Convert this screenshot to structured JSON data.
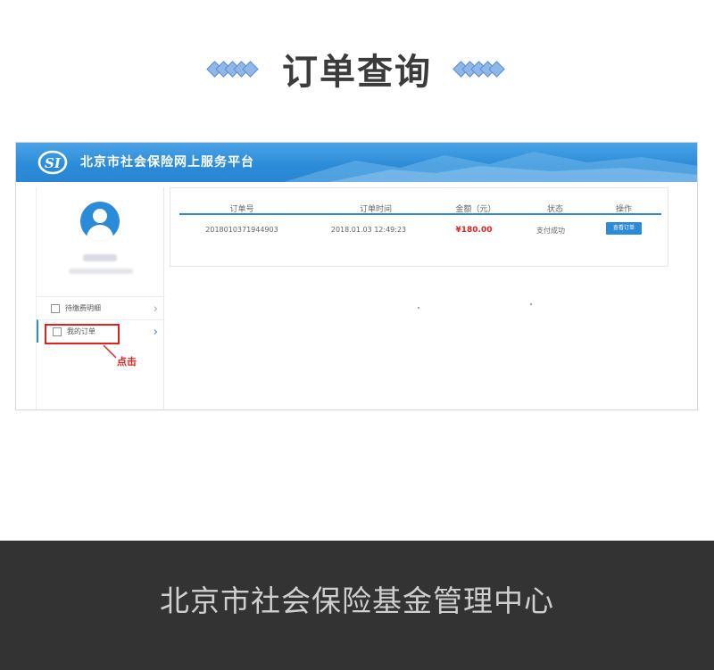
{
  "heading": {
    "title": "订单查询"
  },
  "portal": {
    "title": "北京市社会保险网上服务平台",
    "logo_text": "SI"
  },
  "sidebar": {
    "items": [
      {
        "label": "待缴费明细"
      },
      {
        "label": "我的订单"
      }
    ]
  },
  "annotation": {
    "callout": "点击"
  },
  "orders": {
    "columns": [
      "订单号",
      "订单时间",
      "金额（元）",
      "状态",
      "操作"
    ],
    "rows": [
      {
        "order_no": "2018010371944903",
        "time": "2018.01.03 12:49:23",
        "amount": "¥180.00",
        "status": "支付成功",
        "action": "查看订单"
      }
    ]
  },
  "footer": {
    "text": "北京市社会保险基金管理中心"
  },
  "colors": {
    "accent": "#2b8bd8",
    "highlight": "#e0231f",
    "footer_bg": "#333333"
  }
}
